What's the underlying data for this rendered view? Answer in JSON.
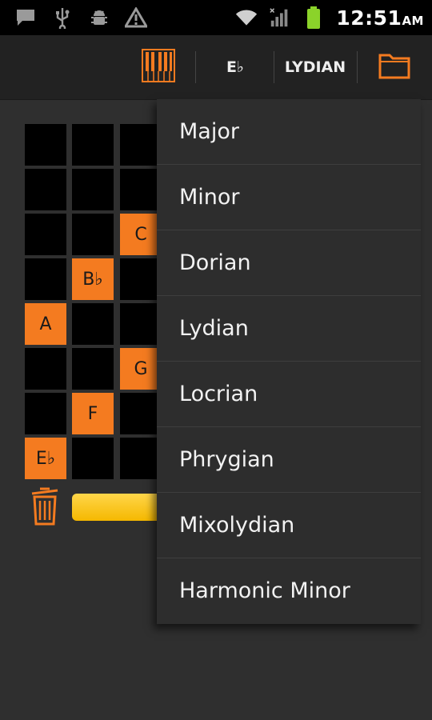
{
  "status_bar": {
    "icons": [
      "message-icon",
      "usb-icon",
      "android-debug-icon",
      "warning-icon",
      "wifi-icon",
      "signal-icon",
      "battery-icon"
    ],
    "time": "12:51",
    "ampm": "AM"
  },
  "action_bar": {
    "key_label": "E♭",
    "mode_label": "LYDIAN",
    "accent_color": "#f47b20"
  },
  "grid": {
    "notes": [
      "C",
      "B♭",
      "A",
      "G",
      "F",
      "E♭"
    ]
  },
  "scale_menu": {
    "items": [
      "Major",
      "Minor",
      "Dorian",
      "Lydian",
      "Locrian",
      "Phrygian",
      "Mixolydian",
      "Harmonic Minor"
    ]
  }
}
